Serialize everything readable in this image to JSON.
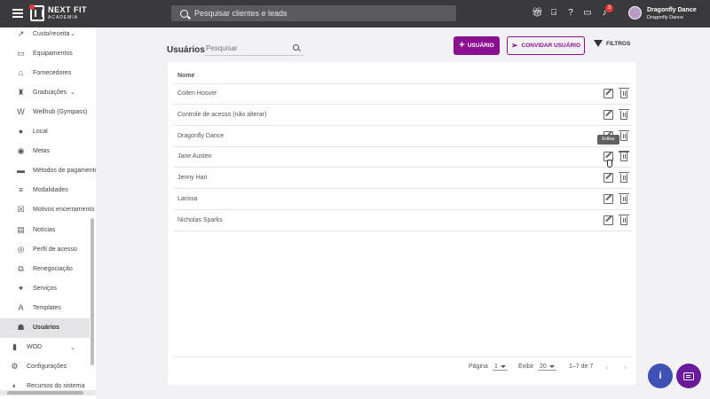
{
  "topbar": {
    "logo": {
      "name": "NEXT FIT",
      "tagline": "ACADEMIA"
    },
    "search_placeholder": "Pesquisar clientes e leads",
    "notification_count": "3",
    "user": {
      "name": "Dragonfly Dance",
      "account": "Dragonfly Dance"
    }
  },
  "sidebar": {
    "items": [
      {
        "label": "Custo/receita",
        "icon": "trend-icon",
        "glyph": "↗",
        "expandable": true
      },
      {
        "label": "Equipamentos",
        "icon": "equipment-icon",
        "glyph": "▭"
      },
      {
        "label": "Fornecedores",
        "icon": "basket-icon",
        "glyph": "⌂"
      },
      {
        "label": "Graduações",
        "icon": "trophy-icon",
        "glyph": "♜",
        "expandable": true
      },
      {
        "label": "Wellhub (Gympass)",
        "icon": "wellhub-icon",
        "glyph": "W"
      },
      {
        "label": "Local",
        "icon": "location-pin-icon",
        "glyph": "●"
      },
      {
        "label": "Metas",
        "icon": "target-icon",
        "glyph": "◉"
      },
      {
        "label": "Métodos de pagamento",
        "icon": "credit-card-icon",
        "glyph": "▬"
      },
      {
        "label": "Modalidades",
        "icon": "list-icon",
        "glyph": "≡"
      },
      {
        "label": "Motivos encerramento",
        "icon": "close-box-icon",
        "glyph": "☒"
      },
      {
        "label": "Notícias",
        "icon": "news-icon",
        "glyph": "▤"
      },
      {
        "label": "Perfil de acesso",
        "icon": "eye-icon",
        "glyph": "◎"
      },
      {
        "label": "Renegociação",
        "icon": "renegotiation-icon",
        "glyph": "⧉"
      },
      {
        "label": "Serviços",
        "icon": "services-icon",
        "glyph": "✦"
      },
      {
        "label": "Templates",
        "icon": "template-icon",
        "glyph": "A"
      },
      {
        "label": "Usuários",
        "icon": "user-badge-icon",
        "glyph": "☗",
        "active": true
      },
      {
        "label": "WOD",
        "icon": "wod-icon",
        "glyph": "▮",
        "expandable": true,
        "top_level": true
      },
      {
        "label": "Configurações",
        "icon": "gear-icon",
        "glyph": "⚙",
        "top_level": true
      },
      {
        "label": "Recursos do sistema",
        "icon": "toggle-icon",
        "glyph": "◐",
        "top_level": true
      }
    ]
  },
  "main": {
    "title": "Usuários",
    "search_placeholder": "Pesquisar",
    "add_button": "USUÁRIO",
    "invite_button": "CONVIDAR USUÁRIO",
    "filter_button": "FILTROS",
    "column_header": "Nome",
    "rows": [
      "Collen Hoover",
      "Controle de acesso (não alterar)",
      "Dragonfly Dance",
      "Jane Austen",
      "Jenny Han",
      "Larissa",
      "Nicholas Sparks"
    ],
    "tooltip": "Editar",
    "pagination": {
      "page_label": "Página",
      "page": "1",
      "show_label": "Exibir",
      "per_page": "20",
      "range": "1–7 de 7"
    }
  },
  "colors": {
    "topbar": "#3a3a3c",
    "accent": "#8b1090",
    "info_fab": "#3f51b5",
    "chat_fab": "#6a1b9a",
    "badge": "#e53935"
  }
}
